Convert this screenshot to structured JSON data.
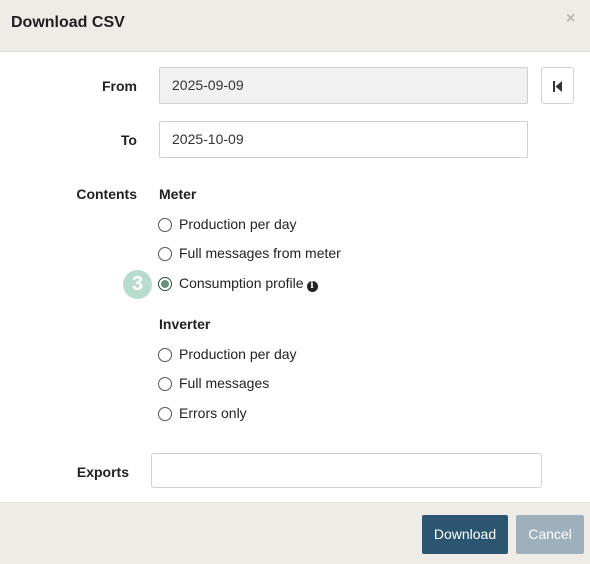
{
  "dialog": {
    "title": "Download CSV",
    "close_glyph": "×"
  },
  "form": {
    "from_label": "From",
    "from_value": "2025-09-09",
    "to_label": "To",
    "to_value": "2025-10-09",
    "contents_label": "Contents",
    "exports_label": "Exports",
    "exports_value": ""
  },
  "meter": {
    "title": "Meter",
    "options": [
      {
        "label": "Production per day",
        "checked": false
      },
      {
        "label": "Full messages from meter",
        "checked": false
      },
      {
        "label": "Consumption profile",
        "checked": true
      }
    ]
  },
  "inverter": {
    "title": "Inverter",
    "options": [
      {
        "label": "Production per day",
        "checked": false
      },
      {
        "label": "Full messages",
        "checked": false
      },
      {
        "label": "Errors only",
        "checked": false
      }
    ]
  },
  "step_badge": "3",
  "info_glyph": "i",
  "footer": {
    "download_label": "Download",
    "cancel_label": "Cancel"
  },
  "colors": {
    "header_bg": "#efece7",
    "primary_button": "#2c5571",
    "disabled_button": "#9db0bc",
    "step_badge": "#b7dccd"
  },
  "icons": {
    "close": "close-icon",
    "first_page": "skip-to-start-icon",
    "info": "info-icon"
  }
}
